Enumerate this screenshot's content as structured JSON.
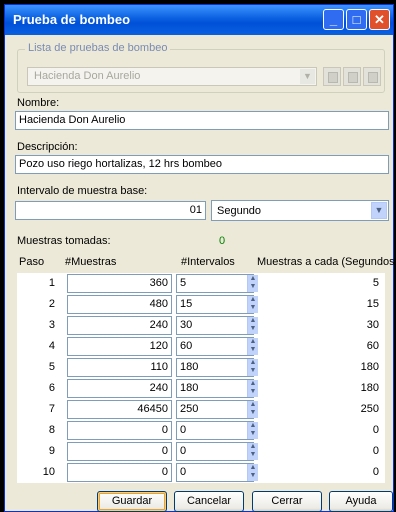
{
  "window": {
    "title": "Prueba de bombeo"
  },
  "lista": {
    "legend": "Lista de pruebas de bombeo",
    "selected": "Hacienda Don Aurelio"
  },
  "nombre": {
    "label": "Nombre:",
    "value": "Hacienda Don Aurelio"
  },
  "descripcion": {
    "label": "Descripción:",
    "value": "Pozo uso riego hortalizas, 12 hrs bombeo"
  },
  "intervalo": {
    "label": "Intervalo de muestra base:",
    "value": "01",
    "unit": "Segundo"
  },
  "muestras": {
    "label": "Muestras tomadas:",
    "count": "0"
  },
  "table": {
    "headers": [
      "Paso",
      "#Muestras",
      "#Intervalos",
      "Muestras a cada (Segundos)"
    ],
    "rows": [
      {
        "paso": "1",
        "muestras": "360",
        "intervalos": "5",
        "segundos": "5"
      },
      {
        "paso": "2",
        "muestras": "480",
        "intervalos": "15",
        "segundos": "15"
      },
      {
        "paso": "3",
        "muestras": "240",
        "intervalos": "30",
        "segundos": "30"
      },
      {
        "paso": "4",
        "muestras": "120",
        "intervalos": "60",
        "segundos": "60"
      },
      {
        "paso": "5",
        "muestras": "110",
        "intervalos": "180",
        "segundos": "180"
      },
      {
        "paso": "6",
        "muestras": "240",
        "intervalos": "180",
        "segundos": "180"
      },
      {
        "paso": "7",
        "muestras": "46450",
        "intervalos": "250",
        "segundos": "250"
      },
      {
        "paso": "8",
        "muestras": "0",
        "intervalos": "0",
        "segundos": "0"
      },
      {
        "paso": "9",
        "muestras": "0",
        "intervalos": "0",
        "segundos": "0"
      },
      {
        "paso": "10",
        "muestras": "0",
        "intervalos": "0",
        "segundos": "0"
      }
    ]
  },
  "buttons": {
    "guardar": "Guardar",
    "cancelar": "Cancelar",
    "cerrar": "Cerrar",
    "ayuda": "Ayuda"
  },
  "icons": [
    "minimize-icon",
    "maximize-icon",
    "close-icon",
    "chevron-down-icon",
    "spin-arrows-icon"
  ],
  "colors": {
    "titlebar": "#0A5FE0",
    "dialog_bg": "#ECE9D8",
    "count_green": "#008000",
    "close_red": "#E0512B"
  }
}
